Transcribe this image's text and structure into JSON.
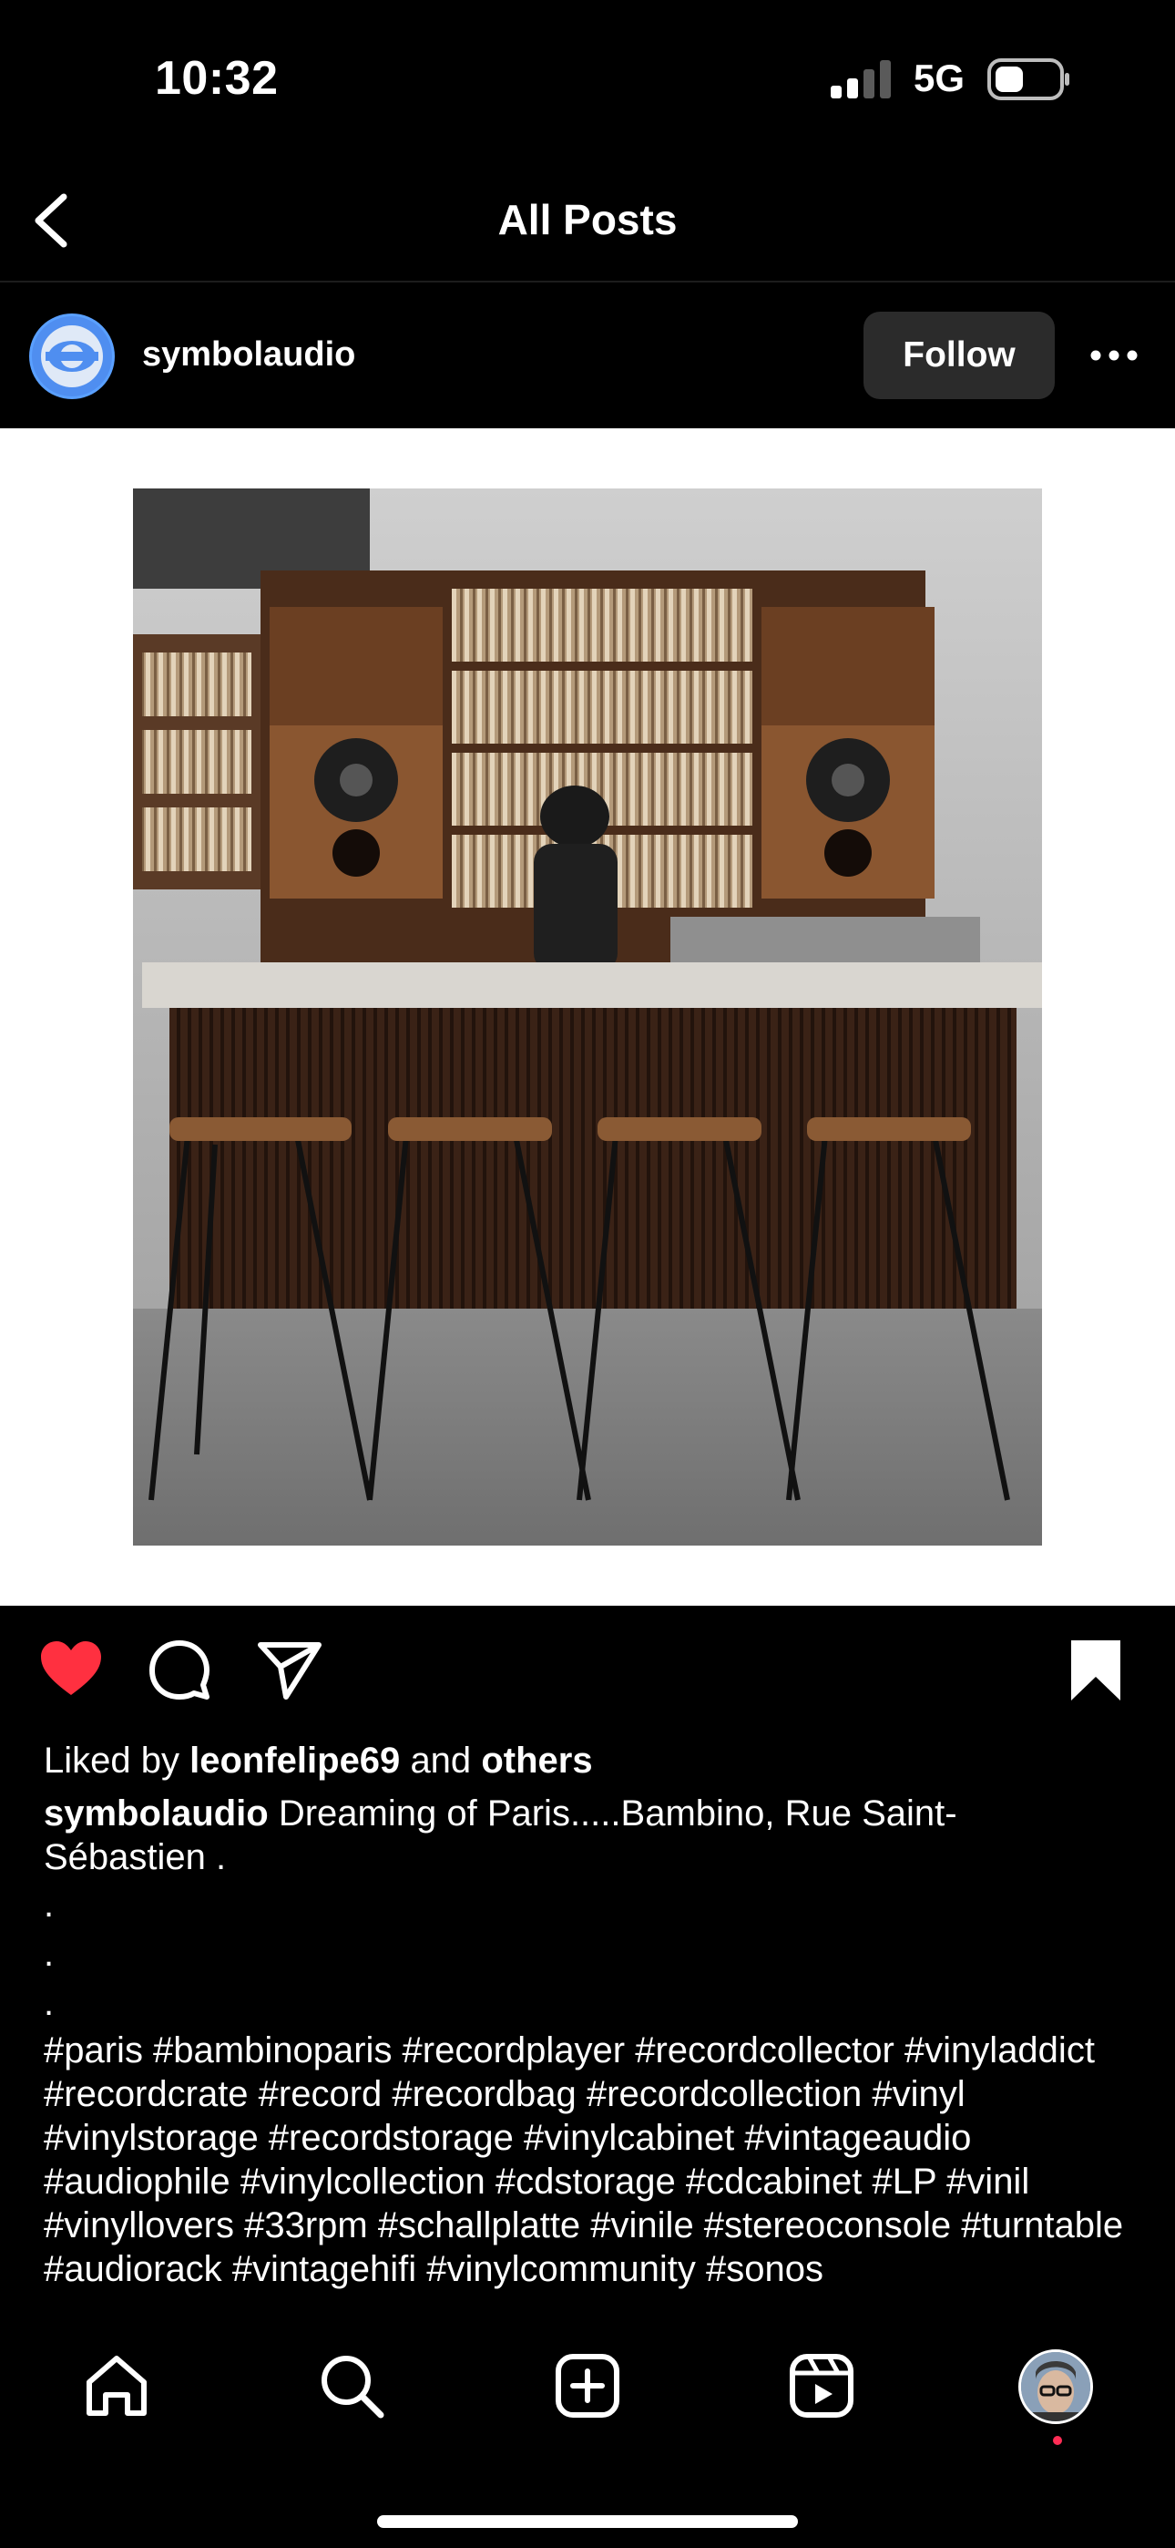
{
  "status": {
    "time": "10:32",
    "network": "5G"
  },
  "nav": {
    "title": "All Posts"
  },
  "post": {
    "username": "symbolaudio",
    "follow_label": "Follow",
    "liked_prefix": "Liked by",
    "liked_user": "leonfelipe69",
    "liked_and": "and",
    "liked_others": "others",
    "caption_user": "symbolaudio",
    "caption_line1": "Dreaming of Paris.....Bambino, Rue Saint-",
    "caption_line2": "Sébastien .",
    "dots": [
      ".",
      ".",
      "."
    ],
    "hashtags": "#paris #bambinoparis #recordplayer #recordcollector #vinyladdict #recordcrate #record #recordbag #recordcollection #vinyl #vinylstorage #recordstorage #vinylcabinet #vintageaudio #audiophile #vinylcollection #cdstorage #cdcabinet #LP #vinil #vinyllovers #33rpm #schallplatte #vinile #stereoconsole #turntable #audiorack #vintagehifi #vinylcommunity #sonos"
  },
  "icons": {
    "back": "chevron-left-icon",
    "more": "more-horizontal-icon",
    "like": "heart-filled-icon",
    "comment": "comment-icon",
    "share": "paper-plane-icon",
    "save": "bookmark-filled-icon",
    "tabs": [
      "home-icon",
      "search-icon",
      "create-icon",
      "reels-icon",
      "profile-avatar"
    ]
  },
  "colors": {
    "like": "#ff3040",
    "background": "#000000",
    "follow_bg": "#2b2b2b",
    "accent_dot": "#ff2d55"
  }
}
